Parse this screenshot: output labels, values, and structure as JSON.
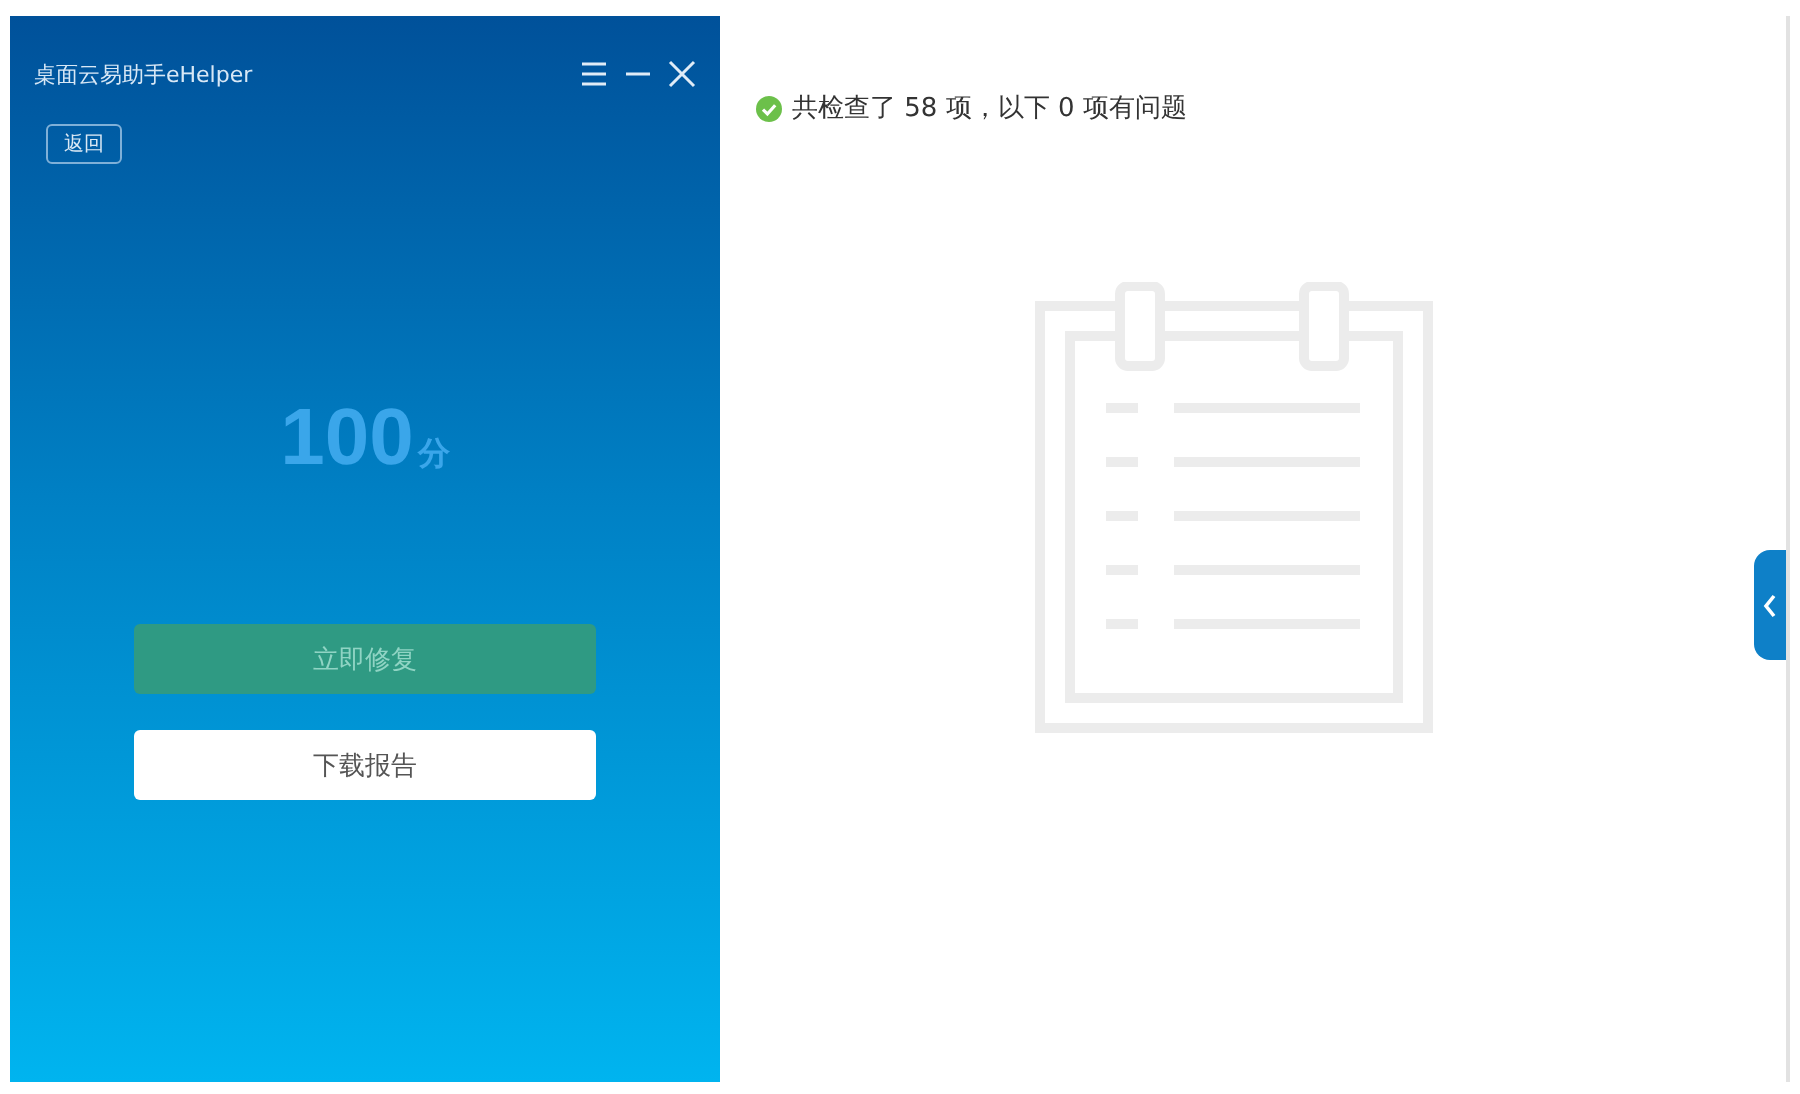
{
  "window": {
    "title": "桌面云易助手eHelper",
    "back_button": "返回"
  },
  "score": {
    "value": "100",
    "unit": "分"
  },
  "buttons": [
    {
      "label": "立即修复",
      "kind": "primary"
    },
    {
      "label": "下载报告",
      "kind": "secondary"
    }
  ],
  "result": {
    "passed": true,
    "message": "共检查了 58 项，以下 0 项有问题"
  }
}
